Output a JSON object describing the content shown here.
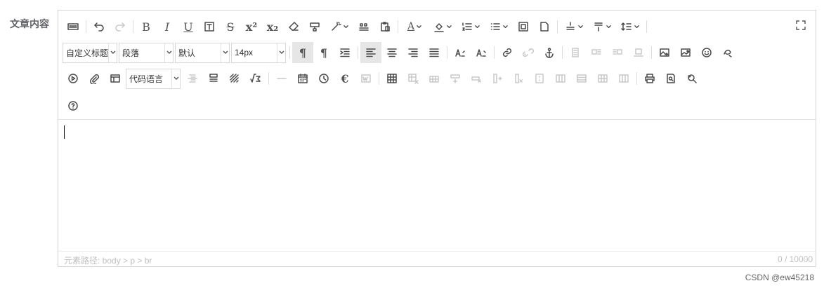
{
  "form": {
    "label": "文章内容"
  },
  "toolbar": {
    "block_format": "自定义标题",
    "paragraph_format": "段落",
    "font_family": "默认",
    "font_size": "14px",
    "code_language": "代码语言"
  },
  "statusbar": {
    "path": "元素路径: body > p > br",
    "word_count": "0 / 10000"
  },
  "watermark": "CSDN @ew45218"
}
